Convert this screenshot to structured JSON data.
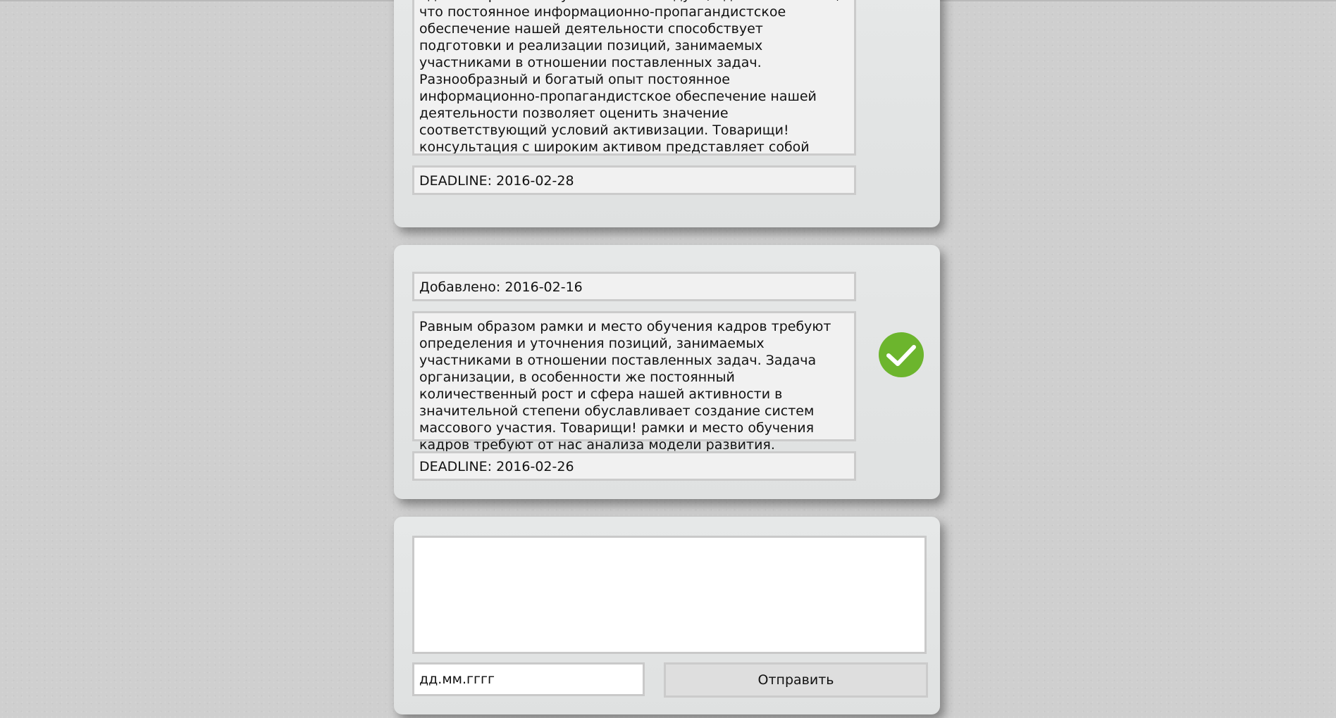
{
  "tasks": [
    {
      "text": "административных условий. Не следует, однако забывать, что постоянное информационно-пропагандистское обеспечение нашей деятельности способствует подготовки и реализации позиций, занимаемых участниками в отношении поставленных задач. Разнообразный и богатый опыт постоянное информационно-пропагандистское обеспечение нашей деятельности позволяет оценить значение соответствующий условий активизации. Товарищи! консультация с широким активом представляет собой интересный эксперимент проверки модели развития.",
      "deadline": "DEADLINE: 2016-02-28"
    },
    {
      "added": "Добавлено: 2016-02-16",
      "text": "Равным образом рамки и место обучения кадров требуют определения и уточнения позиций, занимаемых участниками в отношении поставленных задач. Задача организации, в особенности же постоянный количественный рост и сфера нашей активности в значительной степени обуславливает создание систем массового участия. Товарищи! рамки и место обучения кадров требуют от нас анализа модели развития.",
      "deadline": "DEADLINE: 2016-02-26",
      "status_icon": "check-circle-icon",
      "status_color": "#6cb52d"
    }
  ],
  "form": {
    "textarea_value": "",
    "date_placeholder": "дд.мм.гггг",
    "submit_label": "Отправить"
  }
}
